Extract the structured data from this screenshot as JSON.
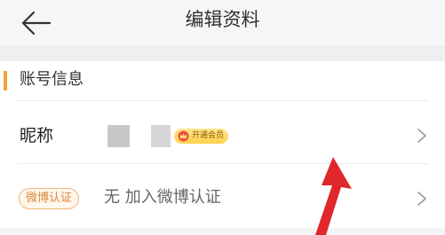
{
  "header": {
    "title": "编辑资料",
    "back_icon": "arrow-left-icon"
  },
  "section": {
    "title": "账号信息",
    "accent_color": "#f2a337"
  },
  "nickname_row": {
    "label": "昵称",
    "vip_badge_label": "开通会员",
    "vip_icon": "crown-icon",
    "chevron_icon": "chevron-right-icon"
  },
  "weibo_row": {
    "badge_label": "微博认证",
    "value": "无 加入微博认证",
    "chevron_icon": "chevron-right-icon"
  },
  "annotation": {
    "icon": "red-pointer-arrow",
    "color": "#e0272b"
  }
}
